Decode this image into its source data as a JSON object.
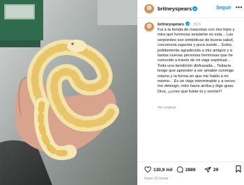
{
  "post": {
    "username": "britneyspears",
    "verified": true,
    "follow_label": "Seguir",
    "more_label": "•••",
    "caption": {
      "username": "britneyspears",
      "time": "15 h",
      "text": "Fui a la tienda de mascotas con mis hijos y mira qué hermosa serpiente es esta... Las serpientes son simbólicas de buena salud, conciencia superior y pura suerte... Estoy jodidamente agradecida a mis amigos y a tantas nuevas personas hermosas que he conocido a través de mi viaje espiritual... Toda una bendición disfrazada... Todavía tengo que aprender a ser amable conmigo mismo y la forma en que me hablo a mí mismo... Es un viaje interminable y a veces me detengo, miro hacia arriba y digo guau Dios, ¡¡¡creo que fuiste tú y sonríe!!!",
      "original_label": "Ver original"
    },
    "actions": {
      "likes": "130,9 mil",
      "comments": "2889",
      "shares": "29"
    },
    "timestamp": "Hace 15 horas"
  },
  "colors": {
    "follow": "#0095f6",
    "verified": "#0095f6",
    "snake": "#f4e8b6",
    "snake_pattern": "#e9c569"
  },
  "icons": [
    "verified-badge-icon",
    "more-icon",
    "heart-icon",
    "comment-icon",
    "share-icon",
    "bookmark-icon"
  ]
}
